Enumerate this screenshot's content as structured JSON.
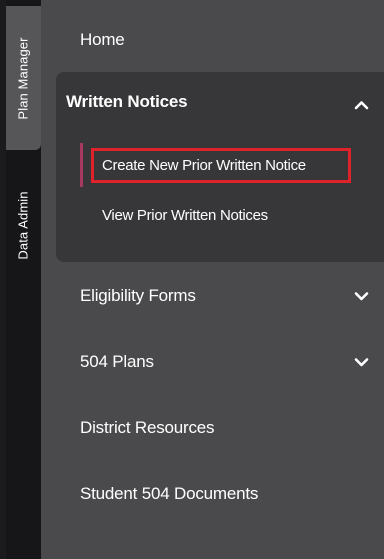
{
  "tabs": [
    {
      "label": "Plan Manager",
      "active": true
    },
    {
      "label": "Data Admin",
      "active": false
    }
  ],
  "nav": {
    "home": "Home",
    "written_notices": {
      "title": "Written Notices",
      "expanded": true,
      "items": [
        {
          "label": "Create New Prior Written Notice",
          "active": true
        },
        {
          "label": "View Prior Written Notices",
          "active": false
        }
      ]
    },
    "eligibility_forms": "Eligibility Forms",
    "plans_504": "504 Plans",
    "district_resources": "District Resources",
    "student_504_documents": "Student 504 Documents"
  },
  "colors": {
    "panel_bg": "#4a4a4c",
    "group_bg": "#373739",
    "active_tab_bg": "#565658",
    "active_accent": "#a8385f",
    "highlight_border": "#e0232a"
  },
  "icons": {
    "expanded": "chevron-up-icon",
    "collapsed": "chevron-down-icon"
  }
}
